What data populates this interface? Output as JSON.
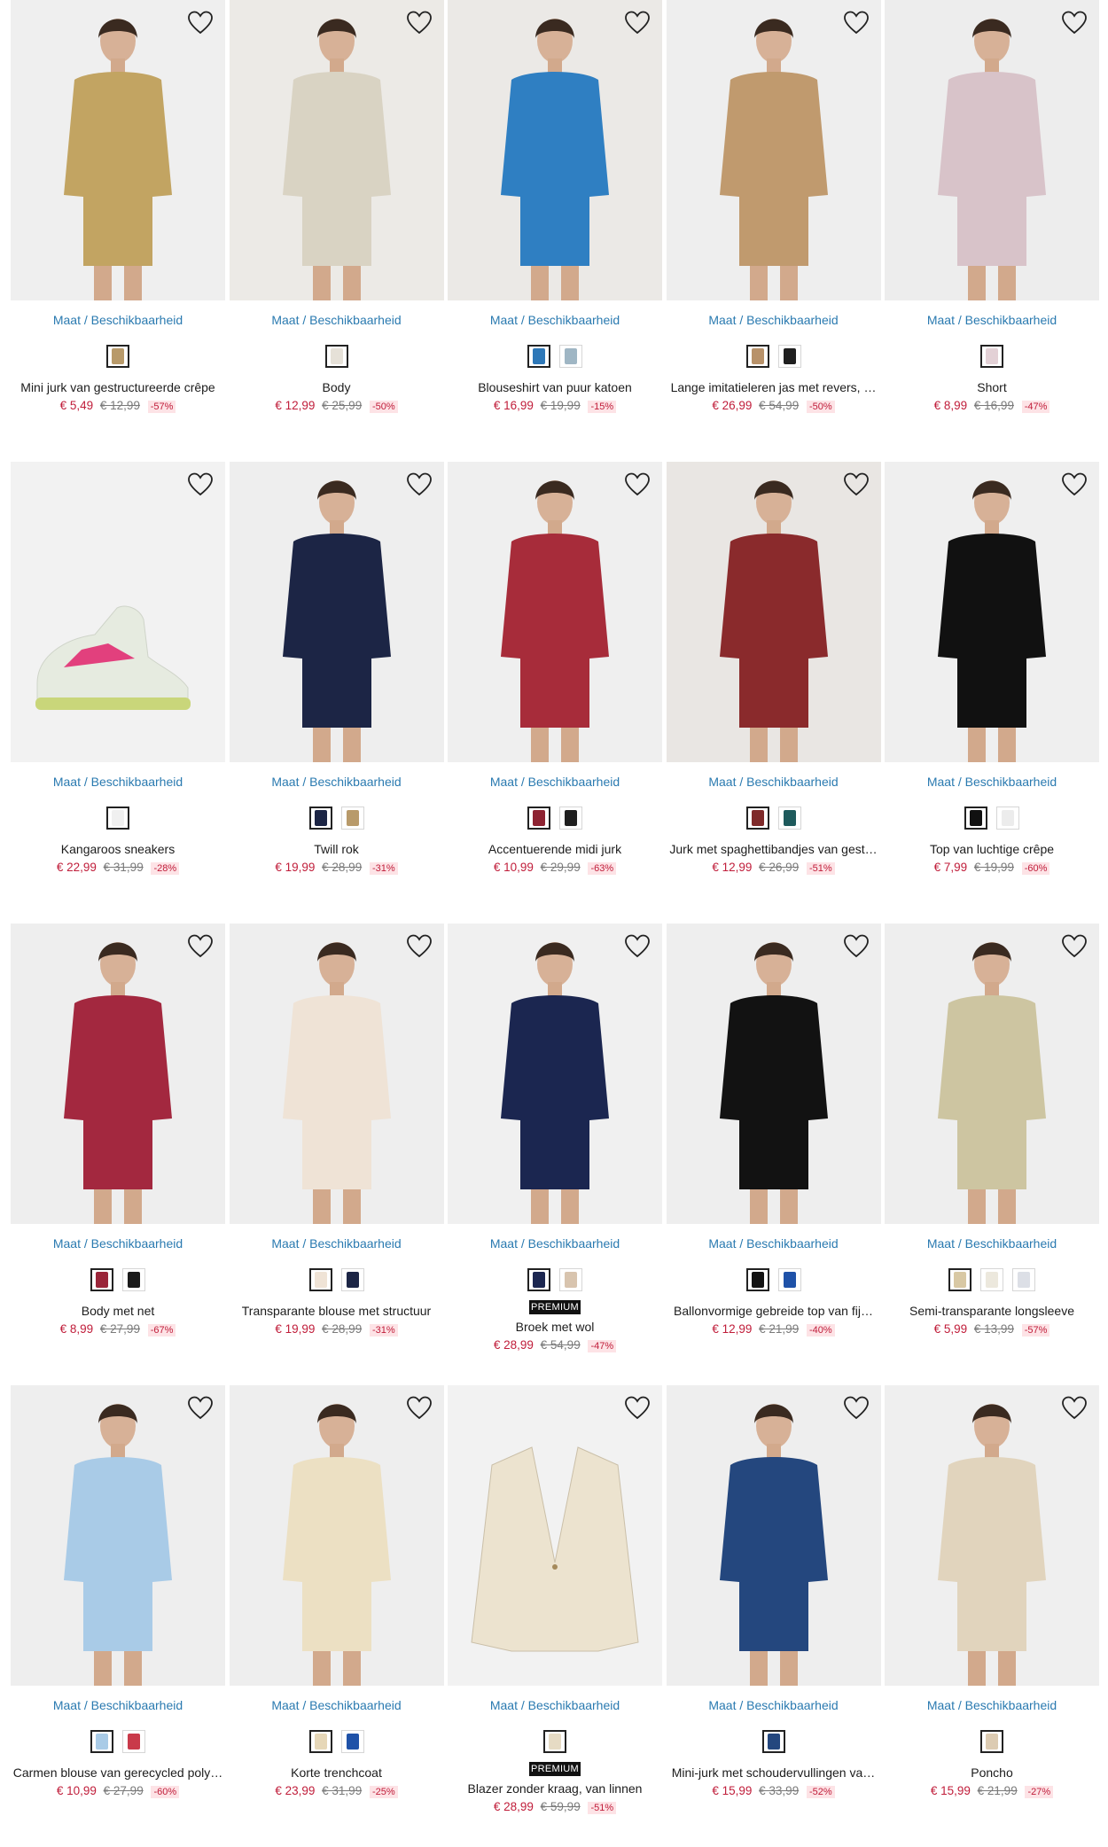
{
  "size_label": "Maat / Beschikbaarheid",
  "premium_label": "PREMIUM",
  "products": [
    {
      "name": "Mini jurk van gestructureerde crêpe",
      "price": "€ 5,49",
      "old_price": "€ 12,99",
      "discount": "-57%",
      "bg": "#efefef",
      "garment": "#c2a462",
      "swatches": [
        "#b89a6a"
      ],
      "premium": false
    },
    {
      "name": "Body",
      "price": "€ 12,99",
      "old_price": "€ 25,99",
      "discount": "-50%",
      "bg": "#eceae6",
      "garment": "#d9d3c3",
      "swatches": [
        "#e6e1d8"
      ],
      "premium": false
    },
    {
      "name": "Blouseshirt van puur katoen",
      "price": "€ 16,99",
      "old_price": "€ 19,99",
      "discount": "-15%",
      "bg": "#ebe9e6",
      "garment": "#2f7fc2",
      "swatches": [
        "#2e78b8",
        "#9fb6c4"
      ],
      "premium": false
    },
    {
      "name": "Lange imitatieleren jas met revers, …",
      "price": "€ 26,99",
      "old_price": "€ 54,99",
      "discount": "-50%",
      "bg": "#eeeeee",
      "garment": "#c09a6e",
      "swatches": [
        "#b8926a",
        "#1f1f1f"
      ],
      "premium": false
    },
    {
      "name": "Short",
      "price": "€ 8,99",
      "old_price": "€ 16,99",
      "discount": "-47%",
      "bg": "#ededed",
      "garment": "#d8c3c9",
      "swatches": [
        "#e3d1d6"
      ],
      "premium": false
    },
    {
      "name": "Kangaroos sneakers",
      "price": "€ 22,99",
      "old_price": "€ 31,99",
      "discount": "-28%",
      "bg": "#f2f2f2",
      "garment": "#e9ece4",
      "swatches": [
        "#f0f0f0"
      ],
      "premium": false
    },
    {
      "name": "Twill rok",
      "price": "€ 19,99",
      "old_price": "€ 28,99",
      "discount": "-31%",
      "bg": "#eeeeee",
      "garment": "#1c2545",
      "swatches": [
        "#1c2545",
        "#b89a6a"
      ],
      "premium": false
    },
    {
      "name": "Accentuerende midi jurk",
      "price": "€ 10,99",
      "old_price": "€ 29,99",
      "discount": "-63%",
      "bg": "#efefef",
      "garment": "#a72c3a",
      "swatches": [
        "#8e2332",
        "#1f1f1f"
      ],
      "premium": false
    },
    {
      "name": "Jurk met spaghettibandjes van gest…",
      "price": "€ 12,99",
      "old_price": "€ 26,99",
      "discount": "-51%",
      "bg": "#e9e6e3",
      "garment": "#8a2a2c",
      "swatches": [
        "#7f2a2a",
        "#1e5a5c"
      ],
      "premium": false
    },
    {
      "name": "Top van luchtige crêpe",
      "price": "€ 7,99",
      "old_price": "€ 19,99",
      "discount": "-60%",
      "bg": "#efefef",
      "garment": "#111111",
      "swatches": [
        "#111111",
        "#ececec"
      ],
      "premium": false
    },
    {
      "name": "Body met net",
      "price": "€ 8,99",
      "old_price": "€ 27,99",
      "discount": "-67%",
      "bg": "#eeeeee",
      "garment": "#a3283f",
      "swatches": [
        "#9a2539",
        "#1a1a1a"
      ],
      "premium": false
    },
    {
      "name": "Transparante blouse met structuur",
      "price": "€ 19,99",
      "old_price": "€ 28,99",
      "discount": "-31%",
      "bg": "#eeeeee",
      "garment": "#efe3d6",
      "swatches": [
        "#efe3d6",
        "#1c2545"
      ],
      "premium": false
    },
    {
      "name": "Broek met wol",
      "price": "€ 28,99",
      "old_price": "€ 54,99",
      "discount": "-47%",
      "bg": "#f0f0f0",
      "garment": "#1b2650",
      "swatches": [
        "#1b2650",
        "#d8c4ae"
      ],
      "premium": true
    },
    {
      "name": "Ballonvormige gebreide top van fij…",
      "price": "€ 12,99",
      "old_price": "€ 21,99",
      "discount": "-40%",
      "bg": "#eeeeee",
      "garment": "#121212",
      "swatches": [
        "#121212",
        "#1f52a8"
      ],
      "premium": false
    },
    {
      "name": "Semi-transparante longsleeve",
      "price": "€ 5,99",
      "old_price": "€ 13,99",
      "discount": "-57%",
      "bg": "#eeeeee",
      "garment": "#cdc5a1",
      "swatches": [
        "#d8c8a4",
        "#ece8dd",
        "#dcdfe6"
      ],
      "premium": false
    },
    {
      "name": "Carmen blouse van gerecycled poly…",
      "price": "€ 10,99",
      "old_price": "€ 27,99",
      "discount": "-60%",
      "bg": "#eeeeee",
      "garment": "#a9cbe7",
      "swatches": [
        "#a9cbe7",
        "#c93a4a"
      ],
      "premium": false
    },
    {
      "name": "Korte trenchcoat",
      "price": "€ 23,99",
      "old_price": "€ 31,99",
      "discount": "-25%",
      "bg": "#eeeeee",
      "garment": "#ece0c3",
      "swatches": [
        "#e6d7b8",
        "#1f52a8"
      ],
      "premium": false
    },
    {
      "name": "Blazer zonder kraag, van linnen",
      "price": "€ 28,99",
      "old_price": "€ 59,99",
      "discount": "-51%",
      "bg": "#f2f2f2",
      "garment": "#ece3cf",
      "swatches": [
        "#e6dbc4"
      ],
      "premium": true
    },
    {
      "name": "Mini-jurk met schoudervullingen va…",
      "price": "€ 15,99",
      "old_price": "€ 33,99",
      "discount": "-52%",
      "bg": "#eeeeee",
      "garment": "#24477e",
      "swatches": [
        "#24477e"
      ],
      "premium": false
    },
    {
      "name": "Poncho",
      "price": "€ 15,99",
      "old_price": "€ 21,99",
      "discount": "-27%",
      "bg": "#efefef",
      "garment": "#e1d4bd",
      "swatches": [
        "#dccbb2"
      ],
      "premium": false
    }
  ]
}
